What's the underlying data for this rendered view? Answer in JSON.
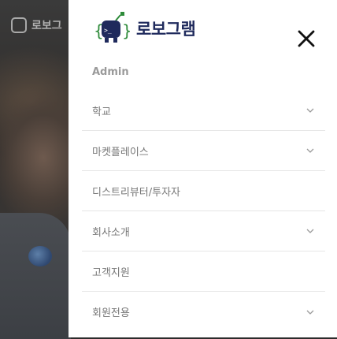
{
  "background": {
    "logo_text": "로보그"
  },
  "header": {
    "logo_text": "로보그램",
    "close_icon": "close-icon",
    "brand_color": "#1f2a5c",
    "accent_color": "#2e8b3a"
  },
  "admin_label": "Admin",
  "menu": {
    "items": [
      {
        "label": "학교",
        "has_submenu": true
      },
      {
        "label": "마켓플레이스",
        "has_submenu": true
      },
      {
        "label": "디스트리뷰터/투자자",
        "has_submenu": false
      },
      {
        "label": "회사소개",
        "has_submenu": true
      },
      {
        "label": "고객지원",
        "has_submenu": false
      },
      {
        "label": "회원전용",
        "has_submenu": true
      }
    ]
  }
}
